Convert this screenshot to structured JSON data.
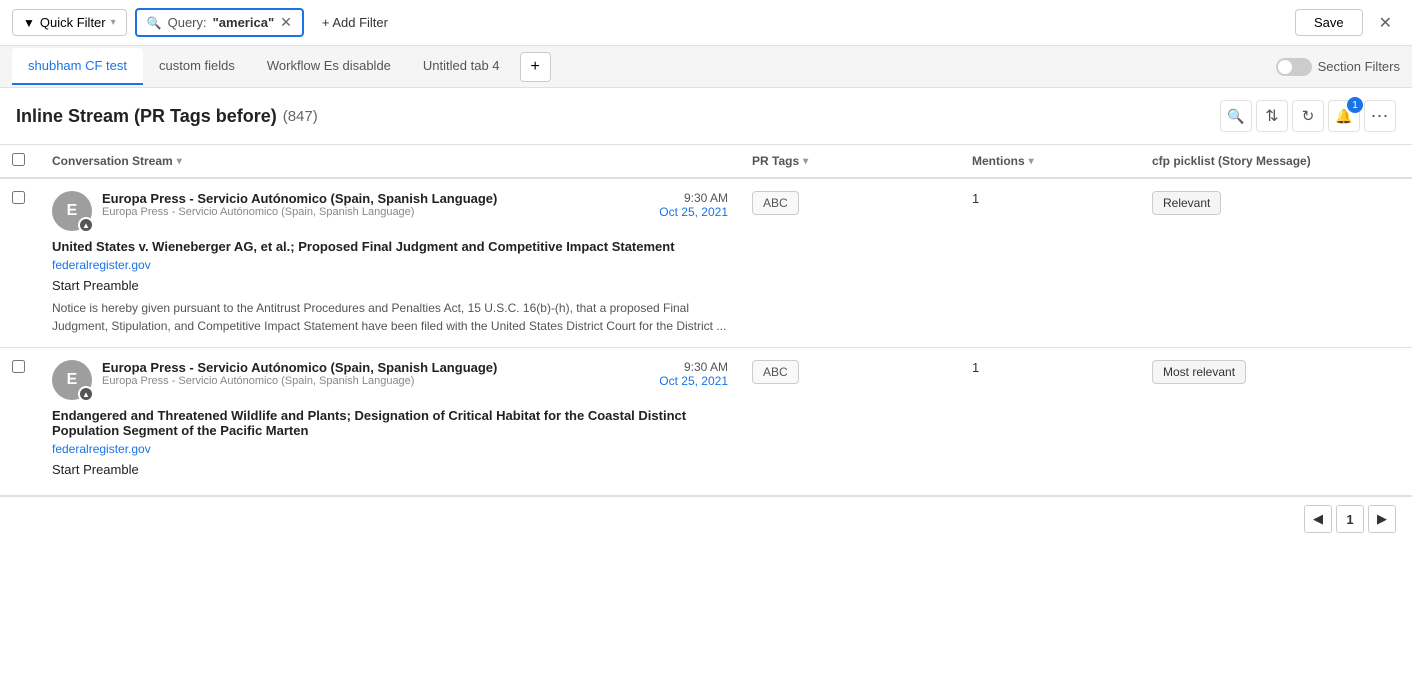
{
  "toolbar": {
    "quick_filter_label": "Quick Filter",
    "query_label": "Query:",
    "query_value": "\"america\"",
    "add_filter_label": "+ Add Filter",
    "save_label": "Save"
  },
  "tabs": {
    "items": [
      {
        "id": "tab-1",
        "label": "shubham CF test",
        "active": true
      },
      {
        "id": "tab-2",
        "label": "custom fields",
        "active": false
      },
      {
        "id": "tab-3",
        "label": "Workflow Es disablde",
        "active": false
      },
      {
        "id": "tab-4",
        "label": "Untitled tab 4",
        "active": false
      }
    ],
    "add_label": "+",
    "section_filters_label": "Section Filters"
  },
  "page": {
    "title": "Inline Stream (PR Tags before)",
    "count": "(847)"
  },
  "columns": {
    "checkbox": "",
    "conversation": "Conversation Stream",
    "pr_tags": "PR Tags",
    "mentions": "Mentions",
    "cfp": "cfp picklist (Story Message)"
  },
  "rows": [
    {
      "id": "row-1",
      "avatar_letter": "E",
      "source_name": "Europa Press - Servicio Autónomico (Spain, Spanish Language)",
      "source_sub": "Europa Press - Servicio Autónomico (Spain, Spanish Language)",
      "time_hour": "9:30 AM",
      "time_date": "Oct 25, 2021",
      "title": "United States v. Wieneberger AG, et al.; Proposed Final Judgment and Competitive Impact Statement",
      "link": "federalregister.gov",
      "preamble": "Start Preamble",
      "body": "Notice is hereby given pursuant to the Antitrust Procedures and Penalties Act, 15 U.S.C. 16(b)-(h), that a proposed Final Judgment, Stipulation, and Competitive Impact Statement have been filed with the United States District Court for the District ...",
      "pr_tag": "ABC",
      "mentions": "1",
      "cfp": "Relevant"
    },
    {
      "id": "row-2",
      "avatar_letter": "E",
      "source_name": "Europa Press - Servicio Autónomico (Spain, Spanish Language)",
      "source_sub": "Europa Press - Servicio Autónomico (Spain, Spanish Language)",
      "time_hour": "9:30 AM",
      "time_date": "Oct 25, 2021",
      "title": "Endangered and Threatened Wildlife and Plants; Designation of Critical Habitat for the Coastal Distinct Population Segment of the Pacific Marten",
      "link": "federalregister.gov",
      "preamble": "Start Preamble",
      "body": "",
      "pr_tag": "ABC",
      "mentions": "1",
      "cfp": "Most relevant"
    }
  ],
  "pagination": {
    "current_page": "1",
    "prev_label": "◀",
    "next_label": "▶"
  },
  "icons": {
    "filter": "⊿",
    "search": "🔍",
    "sort": "⇅",
    "refresh": "↻",
    "bell": "🔔",
    "more": "⋯",
    "close": "✕",
    "chevron_down": "▾",
    "notification_count": "1"
  }
}
